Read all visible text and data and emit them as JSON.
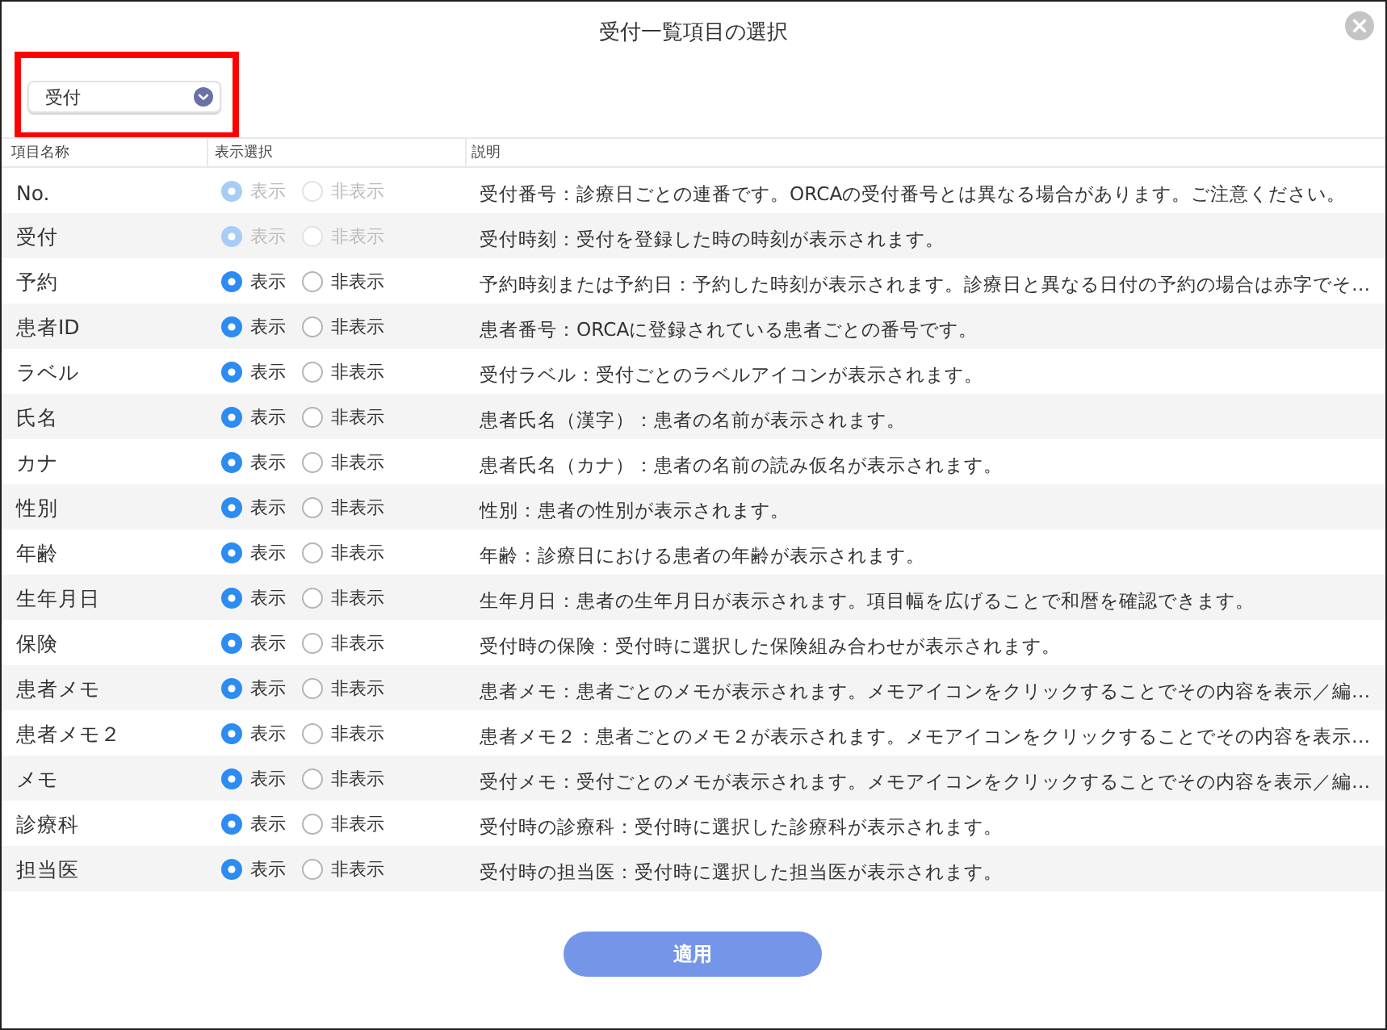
{
  "dialog": {
    "title": "受付一覧項目の選択"
  },
  "category_select": {
    "value": "受付",
    "highlighted": true
  },
  "table": {
    "columns": [
      "項目名称",
      "表示選択",
      "説明"
    ],
    "rows": [
      {
        "name": "No.",
        "disabled": true,
        "options": [
          {
            "label": "表示",
            "selected": true
          },
          {
            "label": "非表示",
            "selected": false
          }
        ],
        "description": "受付番号：診療日ごとの連番です。ORCAの受付番号とは異なる場合があります。ご注意ください。"
      },
      {
        "name": "受付",
        "disabled": true,
        "options": [
          {
            "label": "表示",
            "selected": true
          },
          {
            "label": "非表示",
            "selected": false
          }
        ],
        "description": "受付時刻：受付を登録した時の時刻が表示されます。"
      },
      {
        "name": "予約",
        "disabled": false,
        "options": [
          {
            "label": "表示",
            "selected": true
          },
          {
            "label": "非表示",
            "selected": false
          }
        ],
        "description": "予約時刻または予約日：予約した時刻が表示されます。診療日と異なる日付の予約の場合は赤字でそ…"
      },
      {
        "name": "患者ID",
        "disabled": false,
        "options": [
          {
            "label": "表示",
            "selected": true
          },
          {
            "label": "非表示",
            "selected": false
          }
        ],
        "description": "患者番号：ORCAに登録されている患者ごとの番号です。"
      },
      {
        "name": "ラベル",
        "disabled": false,
        "options": [
          {
            "label": "表示",
            "selected": true
          },
          {
            "label": "非表示",
            "selected": false
          }
        ],
        "description": "受付ラベル：受付ごとのラベルアイコンが表示されます。"
      },
      {
        "name": "氏名",
        "disabled": false,
        "options": [
          {
            "label": "表示",
            "selected": true
          },
          {
            "label": "非表示",
            "selected": false
          }
        ],
        "description": "患者氏名（漢字）：患者の名前が表示されます。"
      },
      {
        "name": "カナ",
        "disabled": false,
        "options": [
          {
            "label": "表示",
            "selected": true
          },
          {
            "label": "非表示",
            "selected": false
          }
        ],
        "description": "患者氏名（カナ）：患者の名前の読み仮名が表示されます。"
      },
      {
        "name": "性別",
        "disabled": false,
        "options": [
          {
            "label": "表示",
            "selected": true
          },
          {
            "label": "非表示",
            "selected": false
          }
        ],
        "description": "性別：患者の性別が表示されます。"
      },
      {
        "name": "年齢",
        "disabled": false,
        "options": [
          {
            "label": "表示",
            "selected": true
          },
          {
            "label": "非表示",
            "selected": false
          }
        ],
        "description": "年齢：診療日における患者の年齢が表示されます。"
      },
      {
        "name": "生年月日",
        "disabled": false,
        "options": [
          {
            "label": "表示",
            "selected": true
          },
          {
            "label": "非表示",
            "selected": false
          }
        ],
        "description": "生年月日：患者の生年月日が表示されます。項目幅を広げることで和暦を確認できます。"
      },
      {
        "name": "保険",
        "disabled": false,
        "options": [
          {
            "label": "表示",
            "selected": true
          },
          {
            "label": "非表示",
            "selected": false
          }
        ],
        "description": "受付時の保険：受付時に選択した保険組み合わせが表示されます。"
      },
      {
        "name": "患者メモ",
        "disabled": false,
        "options": [
          {
            "label": "表示",
            "selected": true
          },
          {
            "label": "非表示",
            "selected": false
          }
        ],
        "description": "患者メモ：患者ごとのメモが表示されます。メモアイコンをクリックすることでその内容を表示／編…"
      },
      {
        "name": "患者メモ２",
        "disabled": false,
        "options": [
          {
            "label": "表示",
            "selected": true
          },
          {
            "label": "非表示",
            "selected": false
          }
        ],
        "description": "患者メモ２：患者ごとのメモ２が表示されます。メモアイコンをクリックすることでその内容を表示…"
      },
      {
        "name": "メモ",
        "disabled": false,
        "options": [
          {
            "label": "表示",
            "selected": true
          },
          {
            "label": "非表示",
            "selected": false
          }
        ],
        "description": "受付メモ：受付ごとのメモが表示されます。メモアイコンをクリックすることでその内容を表示／編…"
      },
      {
        "name": "診療科",
        "disabled": false,
        "options": [
          {
            "label": "表示",
            "selected": true
          },
          {
            "label": "非表示",
            "selected": false
          }
        ],
        "description": "受付時の診療科：受付時に選択した診療科が表示されます。"
      },
      {
        "name": "担当医",
        "disabled": false,
        "options": [
          {
            "label": "表示",
            "selected": true
          },
          {
            "label": "非表示",
            "selected": false
          }
        ],
        "description": "受付時の担当医：受付時に選択した担当医が表示されます。"
      }
    ]
  },
  "apply_button": {
    "label": "適用"
  }
}
